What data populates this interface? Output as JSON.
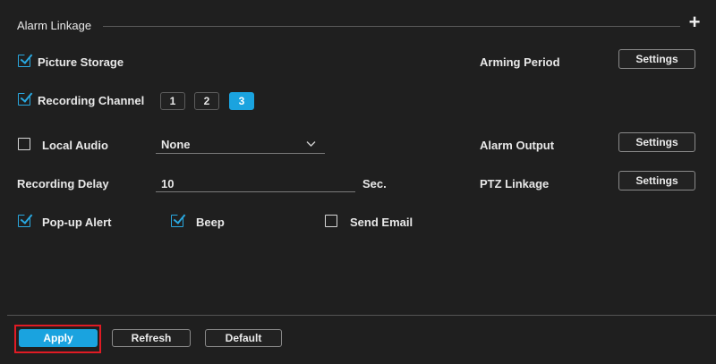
{
  "section": {
    "title": "Alarm Linkage"
  },
  "picture_storage": {
    "label": "Picture Storage",
    "checked": true
  },
  "recording_channel": {
    "label": "Recording Channel",
    "checked": true,
    "channels": [
      "1",
      "2",
      "3"
    ],
    "active": "3"
  },
  "local_audio": {
    "label": "Local Audio",
    "checked": false,
    "value": "None"
  },
  "recording_delay": {
    "label": "Recording Delay",
    "value": "10",
    "unit": "Sec."
  },
  "popup_alert": {
    "label": "Pop-up Alert",
    "checked": true
  },
  "beep": {
    "label": "Beep",
    "checked": true
  },
  "send_email": {
    "label": "Send Email",
    "checked": false
  },
  "arming_period": {
    "label": "Arming Period",
    "button": "Settings"
  },
  "alarm_output": {
    "label": "Alarm Output",
    "button": "Settings"
  },
  "ptz_linkage": {
    "label": "PTZ Linkage",
    "button": "Settings"
  },
  "footer": {
    "apply": "Apply",
    "refresh": "Refresh",
    "default": "Default"
  },
  "colors": {
    "accent": "#1aa3df",
    "highlight": "#e01b24",
    "background": "#1f1f1f"
  }
}
